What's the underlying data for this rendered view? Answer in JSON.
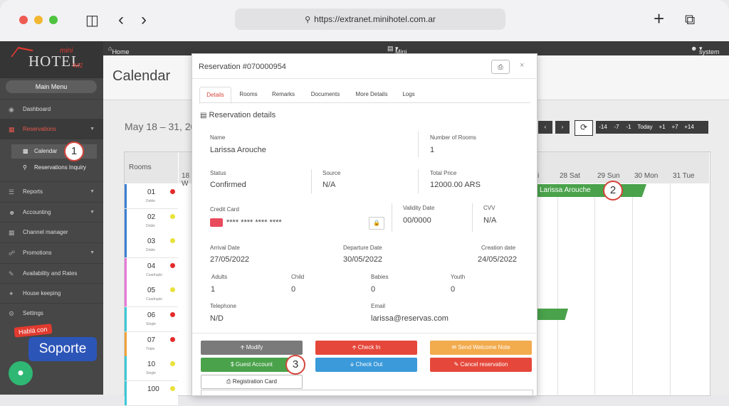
{
  "browser": {
    "url": "https://extranet.minihotel.com.ar"
  },
  "topbar": {
    "home": "Home",
    "hotel": "Mini Hotel Demo",
    "user": "system"
  },
  "logo": {
    "mini": "mini",
    "hotel": "HOTEL",
    "wiz": "WIZ"
  },
  "sidebar": {
    "main_menu": "Main Menu",
    "items": [
      {
        "label": "Dashboard",
        "icon": "dashboard-icon"
      },
      {
        "label": "Reservations",
        "icon": "building-icon"
      },
      {
        "label": "Reports",
        "icon": "list-icon"
      },
      {
        "label": "Accounting",
        "icon": "user-icon"
      },
      {
        "label": "Channel manager",
        "icon": "building-icon"
      },
      {
        "label": "Promotions",
        "icon": "network-icon"
      },
      {
        "label": "Availability and Rates",
        "icon": "pencil-icon"
      },
      {
        "label": "House keeping",
        "icon": "broom-icon"
      },
      {
        "label": "Settings",
        "icon": "gear-icon"
      }
    ],
    "sub_items": [
      {
        "label": "Calendar"
      },
      {
        "label": "Reservations Inquiry"
      }
    ]
  },
  "support": {
    "habla": "Hablá con",
    "soporte": "Soporte"
  },
  "page": {
    "title": "Calendar",
    "date_range": "May 18 – 31, 202"
  },
  "nav_buttons": [
    "-14",
    "-7",
    "-1",
    "Today",
    "+1",
    "+7",
    "+14"
  ],
  "calendar": {
    "rooms_header": "Rooms",
    "first_day": "18 W",
    "partial_day": "i",
    "days": [
      "28 Sat",
      "29 Sun",
      "30 Mon",
      "31 Tue"
    ],
    "booking": "Larissa Arouche",
    "rooms": [
      {
        "num": "01",
        "type": "Doble",
        "bar": "#3a7fd5",
        "dot": "#e42a2a"
      },
      {
        "num": "02",
        "type": "Doble",
        "bar": "#3a7fd5",
        "dot": "#e8e23a"
      },
      {
        "num": "03",
        "type": "Doble",
        "bar": "#3a7fd5",
        "dot": "#e8e23a"
      },
      {
        "num": "04",
        "type": "Cuadruple",
        "bar": "#e878d8",
        "dot": "#e42a2a"
      },
      {
        "num": "05",
        "type": "Cuadruple",
        "bar": "#e878d8",
        "dot": "#e8e23a"
      },
      {
        "num": "06",
        "type": "Single",
        "bar": "#3cc9d9",
        "dot": "#e42a2a"
      },
      {
        "num": "07",
        "type": "Triple",
        "bar": "#f0a23a",
        "dot": "#e42a2a"
      },
      {
        "num": "10",
        "type": "Single",
        "bar": "#3cc9d9",
        "dot": "#e8e23a"
      },
      {
        "num": "100",
        "type": "",
        "bar": "#3cc9d9",
        "dot": "#e8e23a"
      }
    ]
  },
  "badges": [
    "1",
    "2",
    "3"
  ],
  "modal": {
    "title": "Reservation #070000954",
    "tabs": [
      "Details",
      "Rooms",
      "Remarks",
      "Documents",
      "More Details",
      "Logs"
    ],
    "section": "Reservation details",
    "name_label": "Name",
    "name": "Larissa Arouche",
    "rooms_label": "Number of Rooms",
    "rooms": "1",
    "status_label": "Status",
    "status": "Confirmed",
    "source_label": "Source",
    "source": "N/A",
    "total_label": "Total Price",
    "total": "12000.00 ARS",
    "card_label": "Credit Card",
    "card": "**** **** **** ****",
    "validity_label": "Validity Date",
    "validity": "00/0000",
    "cvv_label": "CVV",
    "cvv": "N/A",
    "arrival_label": "Arrival Date",
    "arrival": "27/05/2022",
    "departure_label": "Departure Date",
    "departure": "30/05/2022",
    "creation_label": "Creation date",
    "creation": "24/05/2022",
    "adults_label": "Adults",
    "adults": "1",
    "child_label": "Child",
    "child": "0",
    "babies_label": "Babies",
    "babies": "0",
    "youth_label": "Youth",
    "youth": "0",
    "phone_label": "Telephone",
    "phone": "N/D",
    "email_label": "Email",
    "email": "larissa@reservas.com",
    "buttons": {
      "modify": "Modify",
      "check_in": "Check In",
      "welcome": "Send Welcome Note",
      "guest": "Guest Account",
      "check_out": "Check Out",
      "cancel": "Cancel reservation",
      "registration": "Registration Card"
    }
  },
  "colors": {
    "accent": "#d4453b",
    "green": "#4aa24b",
    "blue": "#3b9ad9",
    "orange": "#f0ad4e",
    "gray": "#777777"
  }
}
